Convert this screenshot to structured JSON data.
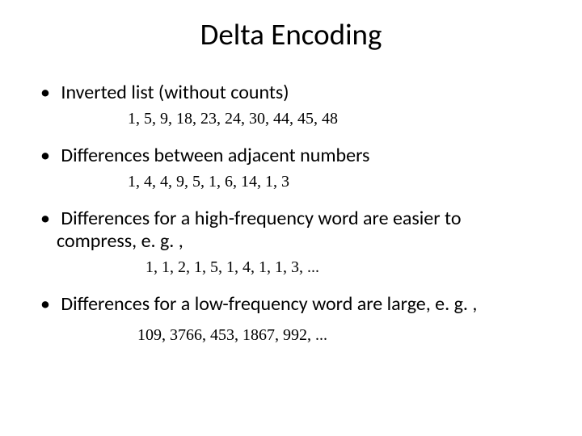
{
  "title": "Delta Encoding",
  "bullets": {
    "b1": "Inverted list (without counts)",
    "b2": "Differences between adjacent numbers",
    "b3": "Differences for a high-frequency word  are easier to compress, e. g. ,",
    "b4": "Differences for a low-frequency word are large, e. g. ,"
  },
  "numbers": {
    "n1": "1, 5, 9, 18, 23, 24, 30, 44, 45, 48",
    "n2": "1, 4, 4, 9, 5, 1, 6, 14, 1, 3",
    "n3": "1, 1, 2, 1, 5, 1, 4, 1, 1, 3, ...",
    "n4": "109, 3766, 453, 1867, 992, ..."
  }
}
